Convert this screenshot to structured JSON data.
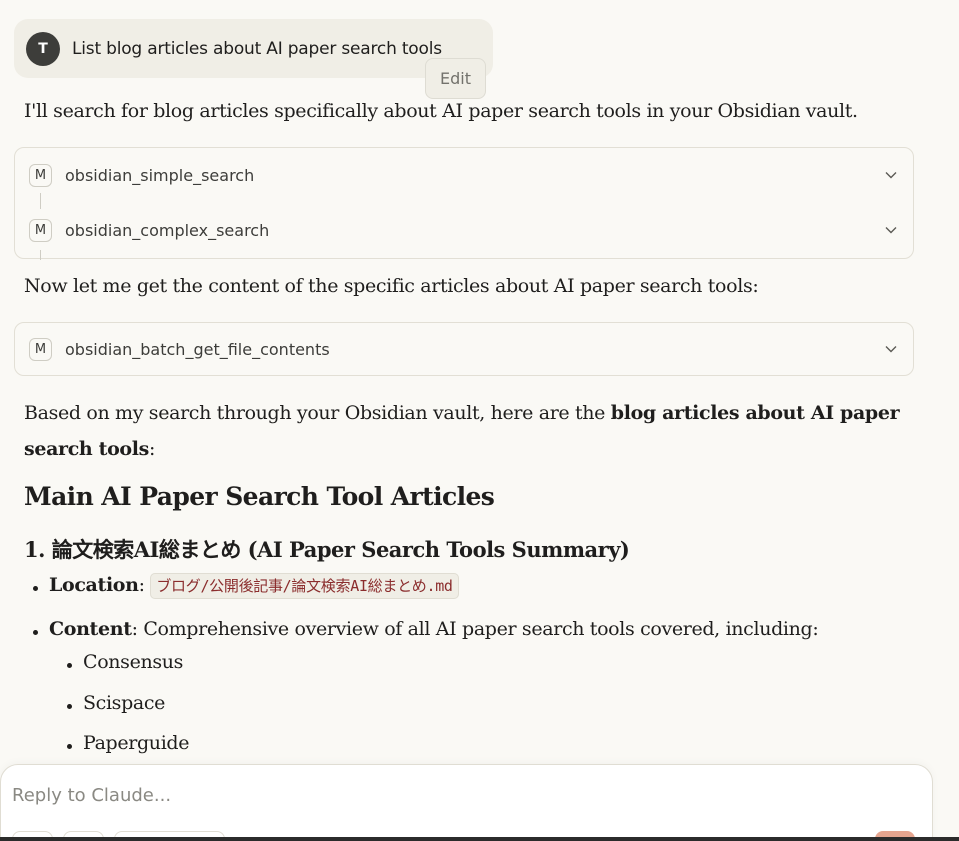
{
  "user_message": {
    "avatar_initial": "T",
    "text": "List blog articles about AI paper search tools",
    "edit_label": "Edit"
  },
  "assistant": {
    "intro": "I'll search for blog articles specifically about AI paper search tools in your Obsidian vault.",
    "tool_group_1": [
      {
        "badge": "M",
        "name": "obsidian_simple_search"
      },
      {
        "badge": "M",
        "name": "obsidian_complex_search"
      }
    ],
    "followup": "Now let me get the content of the specific articles about AI paper search tools:",
    "tool_group_2": [
      {
        "badge": "M",
        "name": "obsidian_batch_get_file_contents"
      }
    ],
    "summary_prefix": "Based on my search through your Obsidian vault, here are the ",
    "summary_bold_1": "blog articles about AI paper",
    "summary_bold_2": "search tools",
    "summary_suffix": ":",
    "heading": "Main AI Paper Search Tool Articles",
    "article_1": {
      "title": "1. 論文検索AI総まとめ (AI Paper Search Tools Summary)",
      "location_label": "Location",
      "location_sep": ": ",
      "location_value": "ブログ/公開後記事/論文検索AI総まとめ.md",
      "content_label": "Content",
      "content_text": ": Comprehensive overview of all AI paper search tools covered, including:",
      "tools": [
        "Consensus",
        "Scispace",
        "Paperguide"
      ]
    }
  },
  "composer": {
    "placeholder": "Reply to Claude..."
  },
  "colors": {
    "background": "#faf9f5",
    "bubble": "#f0eee6",
    "send_button": "#e5a58f",
    "code_text": "#8b2d2d"
  }
}
